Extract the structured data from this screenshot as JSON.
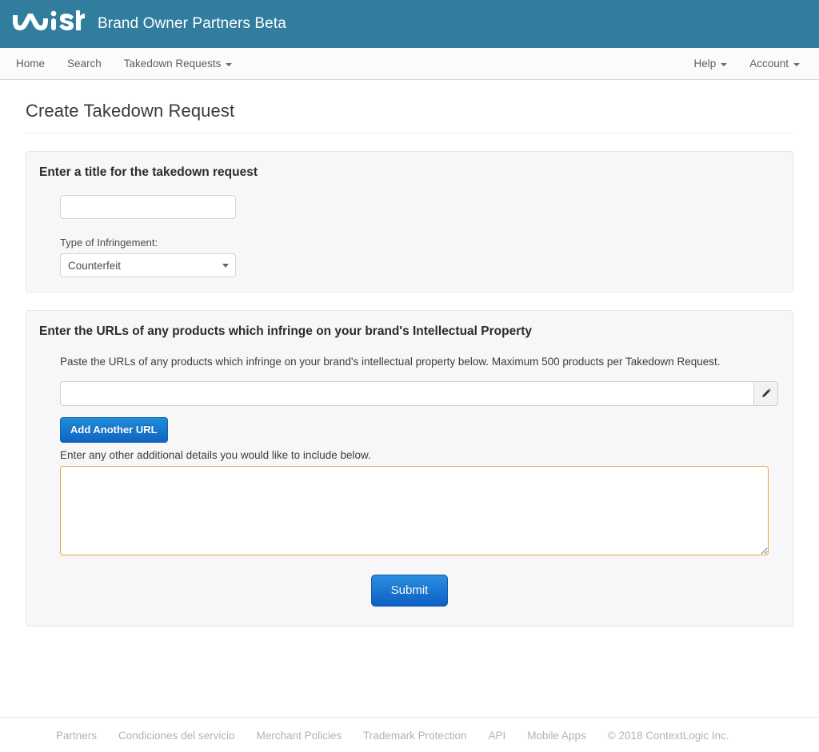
{
  "header": {
    "logo_text": "wish",
    "logo_icon": "wish-wordmark-logo",
    "title": "Brand Owner Partners Beta",
    "brand_color": "#307d9e"
  },
  "navbar": {
    "left_items": [
      {
        "label": "Home",
        "has_caret": false
      },
      {
        "label": "Search",
        "has_caret": false
      },
      {
        "label": "Takedown Requests",
        "has_caret": true
      }
    ],
    "right_items": [
      {
        "label": "Help",
        "has_caret": true
      },
      {
        "label": "Account",
        "has_caret": true
      }
    ]
  },
  "page": {
    "title": "Create Takedown Request"
  },
  "title_panel": {
    "heading": "Enter a title for the takedown request",
    "title_input": {
      "value": "",
      "placeholder": ""
    },
    "infringement_label": "Type of Infringement:",
    "infringement_select": {
      "selected": "Counterfeit",
      "options": [
        "Counterfeit"
      ],
      "icon": "chevron-down-icon"
    }
  },
  "urls_panel": {
    "heading": "Enter the URLs of any products which infringe on your brand's Intellectual Property",
    "help_text": "Paste the URLs of any products which infringe on your brand's intellectual property below. Maximum 500 products per Takedown Request.",
    "url_input": {
      "value": "",
      "placeholder": ""
    },
    "edit_addon_icon": "pencil-icon",
    "add_url_label": "Add Another URL",
    "details_label": "Enter any other additional details you would like to include below.",
    "details_textarea": {
      "value": "",
      "placeholder": "",
      "border_color": "#e8a33d"
    },
    "submit_label": "Submit"
  },
  "footer": {
    "links": [
      "Partners",
      "Condiciones del servicio",
      "Merchant Policies",
      "Trademark Protection",
      "API",
      "Mobile Apps"
    ],
    "copyright": "© 2018 ContextLogic Inc."
  }
}
